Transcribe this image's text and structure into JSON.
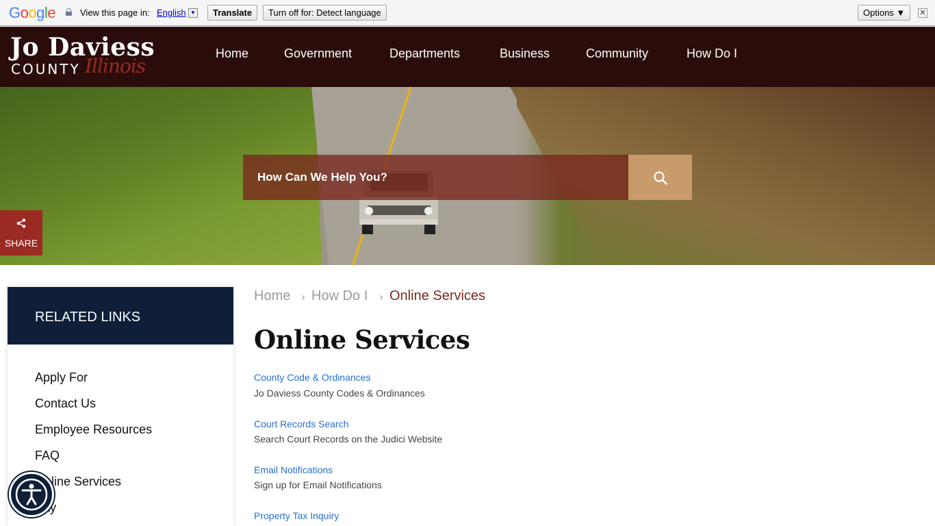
{
  "translate_bar": {
    "logo_text": "Google",
    "view_label": "View this page in:",
    "language": "English",
    "language_dropdown": "▼",
    "translate_button": "Translate",
    "turn_off_button": "Turn off for: Detect language",
    "options_button": "Options ▼",
    "close_button": "✕"
  },
  "header": {
    "logo_line1": "Jo Daviess",
    "logo_line2": "COUNTY",
    "logo_script": "Illinois",
    "nav": [
      "Home",
      "Government",
      "Departments",
      "Business",
      "Community",
      "How Do I"
    ]
  },
  "hero": {
    "search_placeholder": "How Can We Help You?",
    "search_icon": "magnifier-icon",
    "share_label": "SHARE",
    "share_icon": "share-icon"
  },
  "sidebar": {
    "title": "RELATED LINKS",
    "links": [
      "Apply For",
      "Contact Us",
      "Employee Resources",
      "FAQ",
      "Online Services",
      "Pay"
    ]
  },
  "breadcrumb": {
    "items": [
      "Home",
      "How Do I",
      "Online Services"
    ],
    "separator": "›"
  },
  "main": {
    "title": "Online Services",
    "services": [
      {
        "link": "County Code & Ordinances",
        "desc": "Jo Daviess County Codes & Ordinances"
      },
      {
        "link": "Court Records Search",
        "desc": "Search Court Records on the Judici Website"
      },
      {
        "link": "Email Notifications",
        "desc": "Sign up for Email Notifications"
      },
      {
        "link": "Property Tax Inquiry",
        "desc": ""
      }
    ]
  },
  "colors": {
    "header_bg": "#2a0d0b",
    "accent_red": "#9b2a22",
    "sidebar_head": "#0f1f3a",
    "link_blue": "#2a6fcf",
    "search_button": "#c79b6a"
  }
}
